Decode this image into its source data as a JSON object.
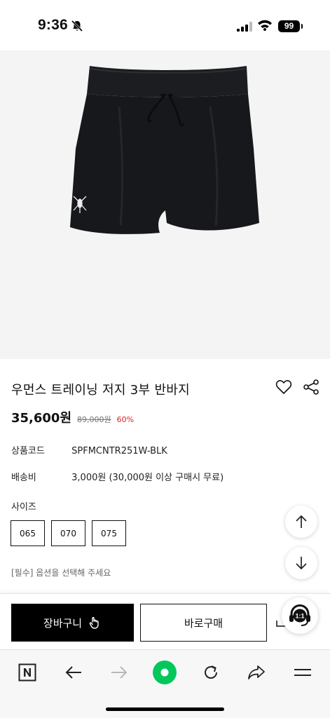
{
  "status_bar": {
    "time": "9:36",
    "battery": "99"
  },
  "product": {
    "title": "우먼스 트레이닝 저지 3부 반바지",
    "sale_price": "35,600원",
    "original_price": "89,000원",
    "discount": "60%",
    "code_label": "상품코드",
    "code_value": "SPFMCNTR251W-BLK",
    "shipping_label": "배송비",
    "shipping_value": "3,000원 (30,000원 이상 구매시 무료)",
    "size_label": "사이즈",
    "sizes": [
      "065",
      "070",
      "075"
    ],
    "size_note": "[필수] 옵션을 선택해 주세요"
  },
  "actions": {
    "cart_label": "장바구니",
    "buy_label": "바로구매",
    "chat_label": "1:1"
  },
  "colors": {
    "accent_black": "#000000",
    "discount_red": "#e02020",
    "naver_green": "#03c75a"
  }
}
